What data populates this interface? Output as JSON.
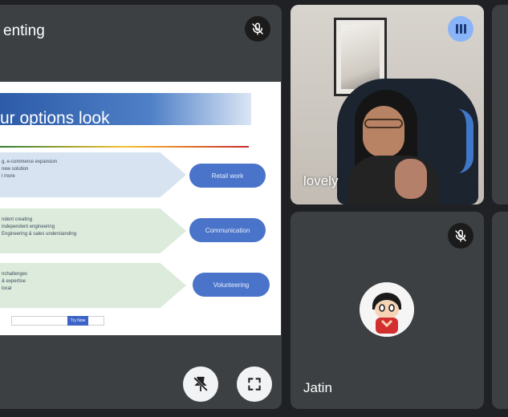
{
  "presentation": {
    "title_partial": "enting",
    "slide": {
      "title": "ur options look",
      "blocks": [
        {
          "lines": "g, e-commerce expansion\nnew solution\nl more",
          "button": "Retail work"
        },
        {
          "lines": "ndent creating\nindependent engineering\nEngineering & sales understanding",
          "button": "Communication"
        },
        {
          "lines": "nchallenges\n& expertise\nlocal",
          "button": "Volunteering"
        }
      ],
      "footer_text": "",
      "footer_button": "Try Now"
    }
  },
  "participants": [
    {
      "name": "lovely",
      "status_icon": "speaking-indicator-icon"
    },
    {
      "name": "Jatin",
      "status_icon": "mic-off-icon"
    }
  ],
  "controls": {
    "unpin_icon": "unpin-icon",
    "fullscreen_icon": "fullscreen-icon"
  },
  "colors": {
    "background": "#202124",
    "tile": "#3c4043",
    "speaking_accent": "#8ab4f8",
    "slide_button": "#4a74c9"
  }
}
